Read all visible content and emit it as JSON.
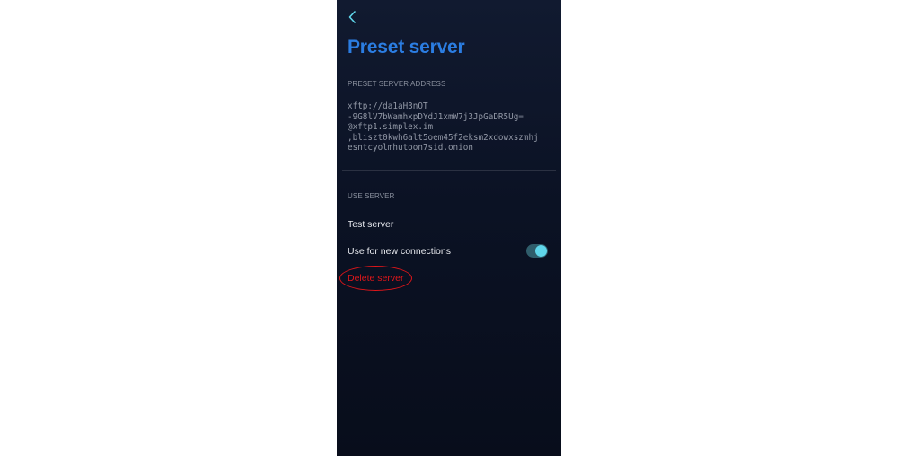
{
  "header": {
    "back_icon": "chevron-left-icon",
    "title": "Preset server"
  },
  "address_section": {
    "label": "PRESET SERVER ADDRESS",
    "lines": [
      "xftp://da1aH3nOT",
      "-9G8lV7bWamhxpDYdJ1xmW7j3JpGaDR5Ug=",
      "@xftp1.simplex.im",
      ",bliszt0kwh6alt5oem45f2eksm2xdowxszmhj",
      "esntcyolmhutoon7sid.onion"
    ]
  },
  "use_section": {
    "label": "USE SERVER",
    "test_server": "Test server",
    "use_for_new": "Use for new connections",
    "use_for_new_enabled": true,
    "delete_server": "Delete server"
  },
  "colors": {
    "title": "#2b7de2",
    "toggle_knob": "#5fd6ea",
    "delete": "#e0161a"
  }
}
